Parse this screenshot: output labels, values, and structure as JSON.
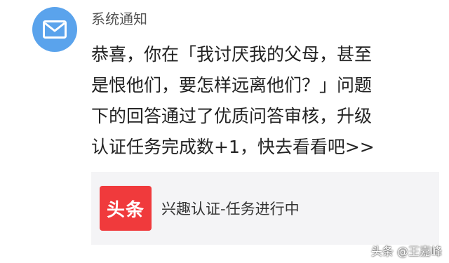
{
  "notification": {
    "sender": "系统通知",
    "avatar_icon": "mail-icon",
    "avatar_color": "#5aa3ec",
    "message_lines": [
      "恭喜，你在「我讨厌我的父母，甚至",
      "是恨他们，要怎样远离他们？」问题",
      "下的回答通过了优质问答审核，升级",
      "认证任务完成数+1，快去看看吧>>"
    ]
  },
  "card": {
    "logo_text": "头条",
    "logo_color": "#f03a3c",
    "title": "兴趣认证-任务进行中"
  },
  "watermark": "头条 @王嘉峰"
}
